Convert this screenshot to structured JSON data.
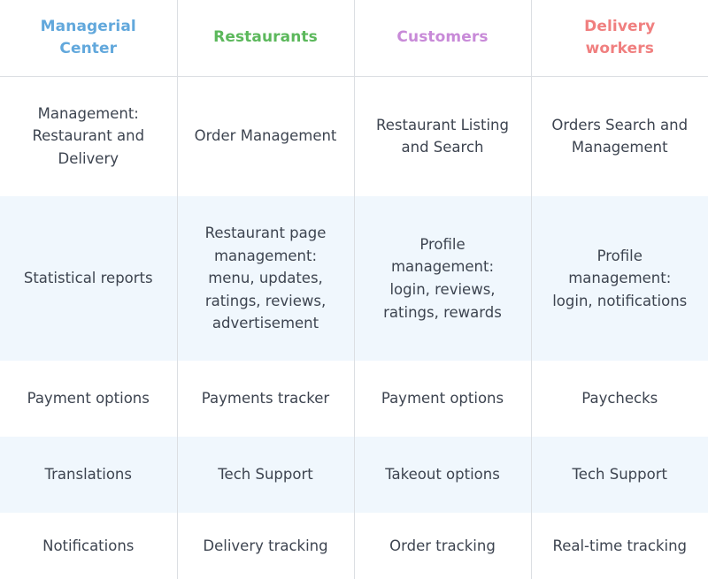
{
  "table": {
    "headers": [
      {
        "label": "Managerial Center",
        "color": "#62a8dc"
      },
      {
        "label": "Restaurants",
        "color": "#5cb85c"
      },
      {
        "label": "Customers",
        "color": "#c88ad8"
      },
      {
        "label": "Delivery workers",
        "color": "#f07f7f"
      }
    ],
    "rows": [
      {
        "shaded": false,
        "cells": [
          "Management: Restaurant and Delivery",
          "Order Management",
          "Restaurant Listing and Search",
          "Orders Search and Management"
        ]
      },
      {
        "shaded": true,
        "cells": [
          "Statistical reports",
          "Restaurant page management: menu, updates, ratings, reviews, advertisement",
          "Profile management: login, reviews, ratings, rewards",
          "Profile management: login, notifications"
        ]
      },
      {
        "shaded": false,
        "cells": [
          "Payment options",
          "Payments tracker",
          "Payment options",
          "Paychecks"
        ]
      },
      {
        "shaded": true,
        "cells": [
          "Translations",
          "Tech Support",
          "Takeout options",
          "Tech Support"
        ]
      },
      {
        "shaded": false,
        "cells": [
          "Notifications",
          "Delivery tracking",
          "Order tracking",
          "Real-time tracking"
        ]
      }
    ]
  },
  "colors": {
    "shaded_row_background": "#f0f7fd",
    "divider": "#dcdfe3",
    "body_text": "#3d4450",
    "page_background": "#ffffff"
  }
}
